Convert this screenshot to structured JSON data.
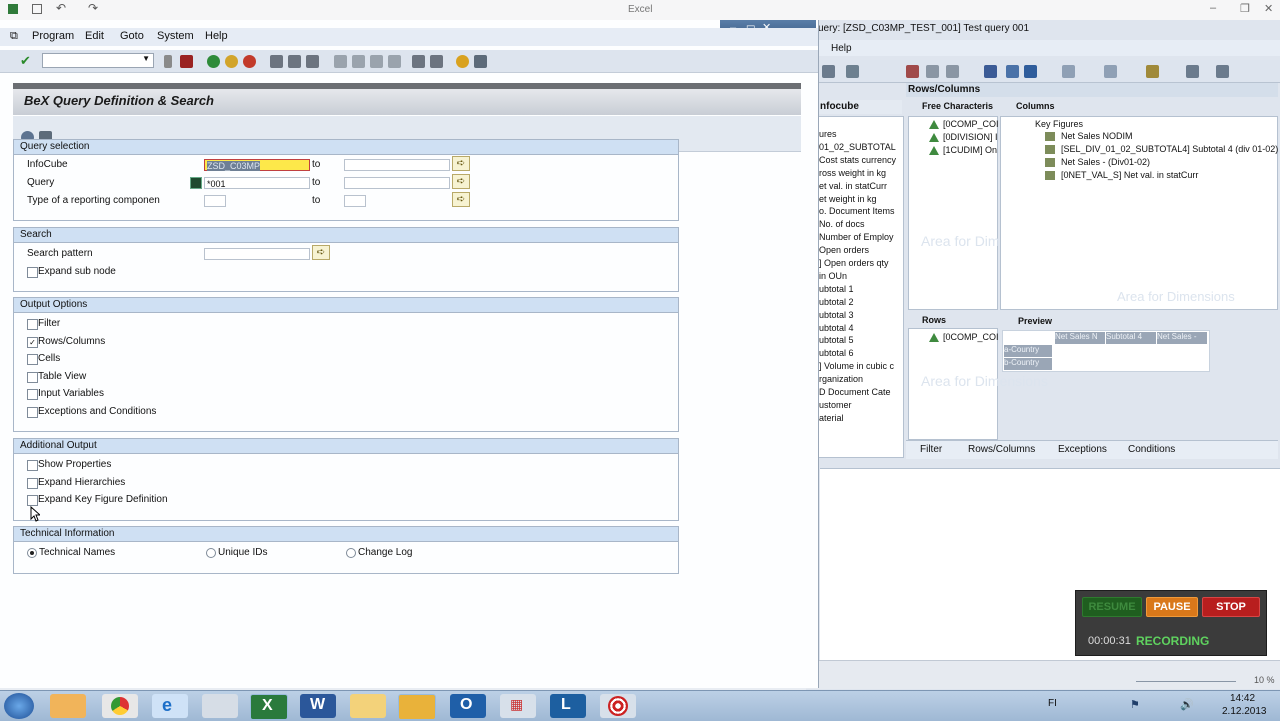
{
  "excel": {
    "app_title": "Excel",
    "query_title": "uery: [ZSD_C03MP_TEST_001] Test query 001",
    "help_menu": "Help",
    "rows_columns_header": "Rows/Columns",
    "infocube_label": "nfocube",
    "free_characteristics_label": "Free Characteris",
    "columns_label": "Columns",
    "free_items": [
      "[0COMP_COI",
      "[0DIVISION] I",
      "[1CUDIM] On"
    ],
    "left_list": [
      "ures",
      "01_02_SUBTOTAL",
      "Cost stats currency",
      "ross weight in kg",
      "et val. in statCurr",
      "et weight in kg",
      "o. Document Items",
      "No. of docs",
      "Number of Employ",
      "Open orders",
      "] Open orders qty",
      "in OUn",
      "ubtotal 1",
      "ubtotal 2",
      "ubtotal 3",
      "ubtotal 4",
      "ubtotal 5",
      "ubtotal 6",
      "] Volume in cubic c",
      "rganization",
      "D Document Cate",
      "ustomer",
      "aterial"
    ],
    "key_figures_label": "Key Figures",
    "key_figures": [
      "Net Sales NODIM",
      "[SEL_DIV_01_02_SUBTOTAL4] Subtotal 4 (div 01-02)",
      "Net Sales - (Div01-02)",
      "[0NET_VAL_S] Net val. in statCurr"
    ],
    "area_dim_1": "Area for Dimensions",
    "area_dim_2": "Area for Dimensions",
    "area_dim_3": "Area for Dimensions",
    "rows_label": "Rows",
    "rows_items": [
      "[0COMP_COI"
    ],
    "preview_label": "Preview",
    "preview_headers": [
      "Net Sales N",
      "Subtotal 4",
      "Net Sales -"
    ],
    "preview_rows": [
      "a-Country",
      "b-Country"
    ],
    "tabs": [
      "Filter",
      "Rows/Columns",
      "Exceptions",
      "Conditions"
    ],
    "zoom": "10 %"
  },
  "sap": {
    "menu": [
      "Program",
      "Edit",
      "Goto",
      "System",
      "Help"
    ],
    "title": "BeX Query Definition & Search",
    "query_selection": {
      "header": "Query selection",
      "infocube_label": "InfoCube",
      "infocube_value": "ZSD_C03MP",
      "query_label": "Query",
      "query_value": "*001",
      "type_label": "Type of a reporting componen",
      "to_label": "to"
    },
    "search": {
      "header": "Search",
      "pattern_label": "Search pattern",
      "expand_label": "Expand sub node"
    },
    "output_options": {
      "header": "Output Options",
      "items": [
        {
          "label": "Filter",
          "checked": ""
        },
        {
          "label": "Rows/Columns",
          "checked": "✓"
        },
        {
          "label": "Cells",
          "checked": ""
        },
        {
          "label": "Table View",
          "checked": ""
        },
        {
          "label": "Input Variables",
          "checked": ""
        },
        {
          "label": "Exceptions and Conditions",
          "checked": ""
        }
      ]
    },
    "additional_output": {
      "header": "Additional Output",
      "items": [
        "Show Properties",
        "Expand Hierarchies",
        "Expand Key Figure Definition"
      ]
    },
    "technical_info": {
      "header": "Technical Information",
      "options": [
        "Technical Names",
        "Unique IDs",
        "Change Log"
      ]
    }
  },
  "recording": {
    "resume": "RESUME",
    "pause": "PAUSE",
    "stop": "STOP",
    "time": "00:00:31",
    "status": "RECORDING"
  },
  "taskbar": {
    "lang": "FI",
    "time": "14:42",
    "date": "2.12.2013"
  }
}
